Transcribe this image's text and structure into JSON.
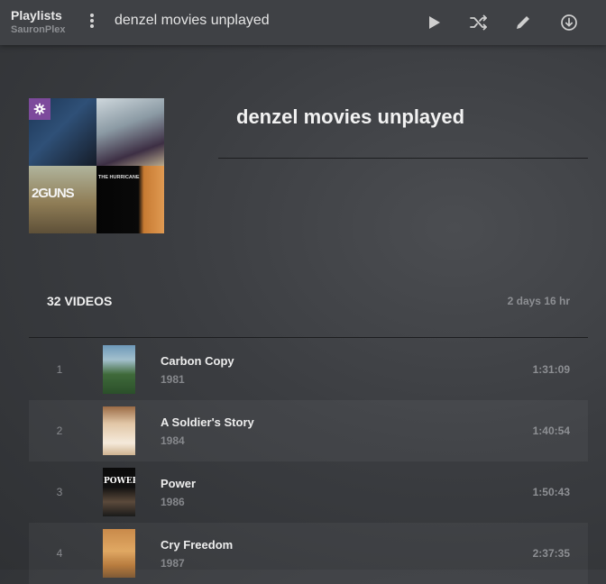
{
  "header": {
    "breadcrumb_title": "Playlists",
    "breadcrumb_sub": "SauronPlex",
    "title": "denzel movies unplayed",
    "icons": [
      "more-vertical-icon",
      "play-icon",
      "shuffle-icon",
      "edit-pencil-icon",
      "download-icon"
    ]
  },
  "playlist": {
    "title": "denzel movies unplayed",
    "count_label": "32 VIDEOS",
    "total_duration": "2 days 16 hr",
    "poster_texts": {
      "tile3": "2GUNS",
      "tile4": "THE HURRICANE"
    },
    "accent_color": "#7d4a9c"
  },
  "items": [
    {
      "index": "1",
      "title": "Carbon Copy",
      "year": "1981",
      "duration": "1:31:09"
    },
    {
      "index": "2",
      "title": "A Soldier's Story",
      "year": "1984",
      "duration": "1:40:54"
    },
    {
      "index": "3",
      "title": "Power",
      "year": "1986",
      "duration": "1:50:43",
      "poster_text": "POWER"
    },
    {
      "index": "4",
      "title": "Cry Freedom",
      "year": "1987",
      "duration": "2:37:35"
    }
  ]
}
